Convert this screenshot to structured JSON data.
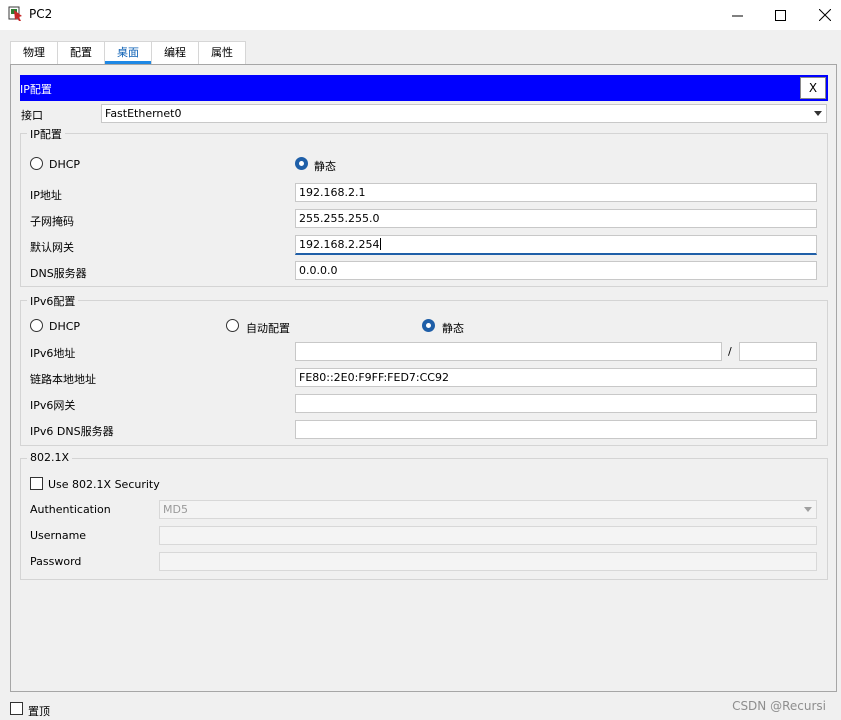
{
  "window": {
    "title": "PC2"
  },
  "tabs": [
    {
      "label": "物理"
    },
    {
      "label": "配置"
    },
    {
      "label": "桌面"
    },
    {
      "label": "编程"
    },
    {
      "label": "属性"
    }
  ],
  "active_tab": "桌面",
  "ip_config": {
    "bar_title": "IP配置",
    "close_label": "X",
    "interface_label": "接口",
    "interface_value": "FastEthernet0",
    "ipv4": {
      "legend": "IP配置",
      "dhcp_label": "DHCP",
      "static_label": "静态",
      "mode": "static",
      "ip_label": "IP地址",
      "ip_value": "192.168.2.1",
      "mask_label": "子网掩码",
      "mask_value": "255.255.255.0",
      "gateway_label": "默认网关",
      "gateway_value": "192.168.2.254",
      "dns_label": "DNS服务器",
      "dns_value": "0.0.0.0"
    },
    "ipv6": {
      "legend": "IPv6配置",
      "dhcp_label": "DHCP",
      "auto_label": "自动配置",
      "static_label": "静态",
      "mode": "static",
      "addr_label": "IPv6地址",
      "addr_value": "",
      "prefix_sep": "/",
      "prefix_value": "",
      "link_local_label": "链路本地地址",
      "link_local_value": "FE80::2E0:F9FF:FED7:CC92",
      "gateway_label": "IPv6网关",
      "gateway_value": "",
      "dns_label": "IPv6 DNS服务器",
      "dns_value": ""
    },
    "dot1x": {
      "legend": "802.1X",
      "use_label": "Use 802.1X Security",
      "auth_label": "Authentication",
      "auth_value": "MD5",
      "username_label": "Username",
      "username_value": "",
      "password_label": "Password",
      "password_value": ""
    }
  },
  "footer": {
    "top_label": "置顶"
  },
  "watermark": "CSDN @Recursi",
  "colors": {
    "blue_bar": "#0000ff",
    "accent": "#1f5fa8",
    "tab_underline": "#1e88e5"
  }
}
